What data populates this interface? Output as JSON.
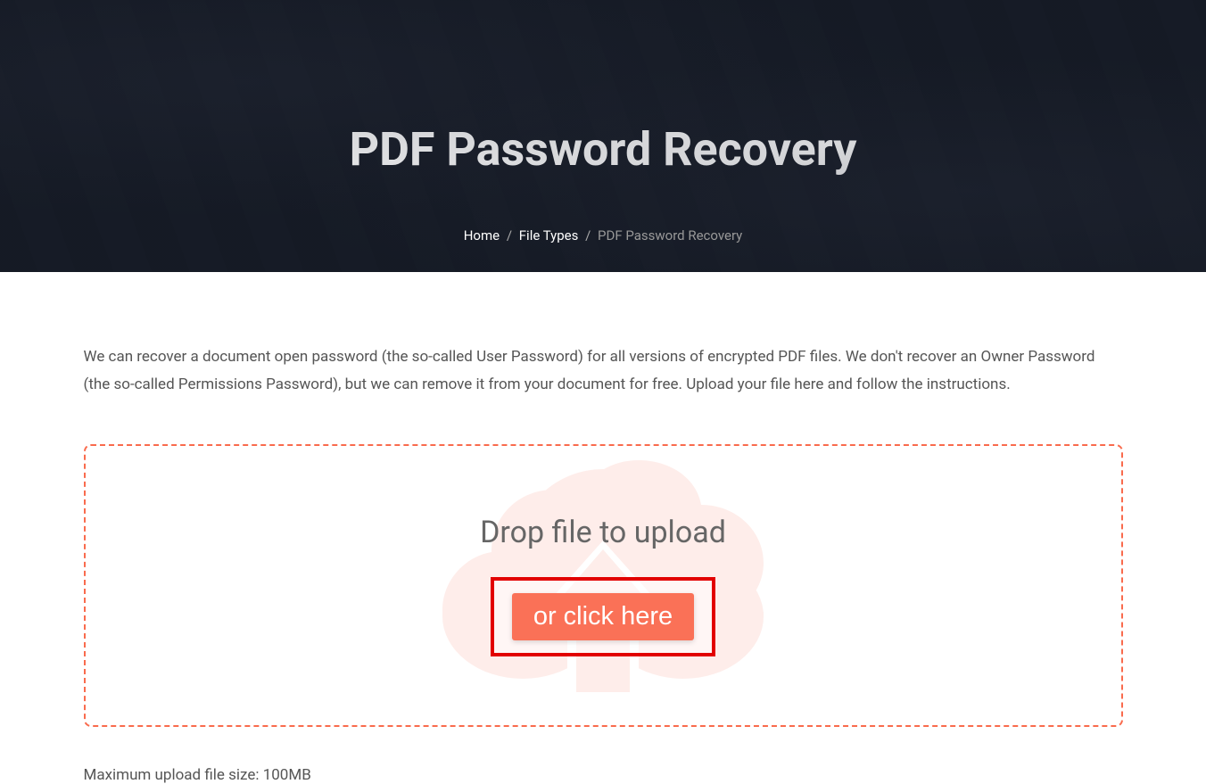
{
  "hero": {
    "title": "PDF Password Recovery"
  },
  "breadcrumb": {
    "home": "Home",
    "file_types": "File Types",
    "current": "PDF Password Recovery",
    "sep": "/"
  },
  "main": {
    "description": "We can recover a document open password (the so-called User Password) for all versions of encrypted PDF files. We don't recover an Owner Password (the so-called Permissions Password), but we can remove it from your document for free. Upload your file here and follow the instructions.",
    "upload_prompt": "Drop file to upload",
    "upload_button": "or click here",
    "file_limit": "Maximum upload file size: 100MB"
  },
  "colors": {
    "accent": "#fa7157",
    "border_dashed": "#f96b4d",
    "highlight": "#e20000"
  }
}
